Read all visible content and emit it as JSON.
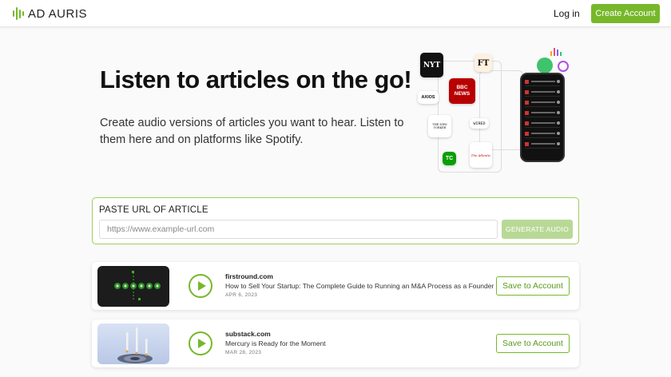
{
  "header": {
    "logo_text": "AD AURIS",
    "login_label": "Log in",
    "create_account_label": "Create Account"
  },
  "hero": {
    "title": "Listen to articles on the go!",
    "subtitle": "Create audio versions of articles you want to hear. Listen to them here and on platforms like Spotify."
  },
  "illustration": {
    "publishers": [
      "NYT",
      "FT",
      "BBC NEWS",
      "AXIOS",
      "THE NEW YORKER",
      "WIRED",
      "TC",
      "The Atlantic"
    ],
    "icons": [
      "podcast-icon",
      "spotify-icon",
      "apple-podcasts-icon",
      "google-podcasts-icon"
    ]
  },
  "url_form": {
    "label": "PASTE URL OF ARTICLE",
    "placeholder": "https://www.example-url.com",
    "value": "",
    "generate_label": "GENERATE AUDIO"
  },
  "articles": [
    {
      "source": "firstround.com",
      "title": "How to Sell Your Startup: The Complete Guide to Running an M&A Process as a Founder",
      "date": "APR 6, 2023",
      "save_label": "Save to Account"
    },
    {
      "source": "substack.com",
      "title": "Mercury is Ready for the Moment",
      "date": "MAR 28, 2023",
      "save_label": "Save to Account"
    }
  ],
  "colors": {
    "brand_green": "#76b82a",
    "disabled_green": "#b8d996",
    "border_green": "#9ccf5e"
  }
}
